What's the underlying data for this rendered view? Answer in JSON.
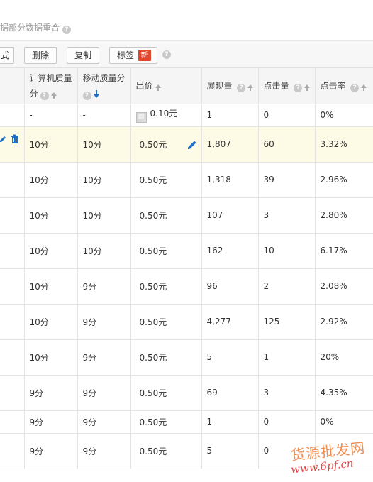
{
  "notice": {
    "text": "据部分数据重合"
  },
  "toolbar": {
    "style_label": "式",
    "delete_label": "删除",
    "copy_label": "复制",
    "tag_label": "标签",
    "new_badge": "新"
  },
  "columns": {
    "pc_quality": "计算机质量",
    "pc_quality_2": "分",
    "mobile_quality": "移动质量分",
    "bid": "出价",
    "impressions": "展现量",
    "clicks": "点击量",
    "ctr": "点击率"
  },
  "rows": [
    {
      "pc_quality": "-",
      "mobile_quality": "-",
      "bid": "0.10元",
      "impressions": "1",
      "clicks": "0",
      "ctr": "0%"
    },
    {
      "pc_quality": "10分",
      "mobile_quality": "10分",
      "bid": "0.50元",
      "impressions": "1,807",
      "clicks": "60",
      "ctr": "3.32%"
    },
    {
      "pc_quality": "10分",
      "mobile_quality": "10分",
      "bid": "0.50元",
      "impressions": "1,318",
      "clicks": "39",
      "ctr": "2.96%"
    },
    {
      "pc_quality": "10分",
      "mobile_quality": "10分",
      "bid": "0.50元",
      "impressions": "107",
      "clicks": "3",
      "ctr": "2.80%"
    },
    {
      "pc_quality": "10分",
      "mobile_quality": "10分",
      "bid": "0.50元",
      "impressions": "162",
      "clicks": "10",
      "ctr": "6.17%"
    },
    {
      "pc_quality": "10分",
      "mobile_quality": "9分",
      "bid": "0.50元",
      "impressions": "96",
      "clicks": "2",
      "ctr": "2.08%"
    },
    {
      "pc_quality": "10分",
      "mobile_quality": "9分",
      "bid": "0.50元",
      "impressions": "4,277",
      "clicks": "125",
      "ctr": "2.92%"
    },
    {
      "pc_quality": "10分",
      "mobile_quality": "9分",
      "bid": "0.50元",
      "impressions": "5",
      "clicks": "1",
      "ctr": "20%"
    },
    {
      "pc_quality": "9分",
      "mobile_quality": "9分",
      "bid": "0.50元",
      "impressions": "69",
      "clicks": "3",
      "ctr": "4.35%"
    },
    {
      "pc_quality": "9分",
      "mobile_quality": "9分",
      "bid": "0.50元",
      "impressions": "1",
      "clicks": "0",
      "ctr": "0%"
    },
    {
      "pc_quality": "9分",
      "mobile_quality": "9分",
      "bid": "0.50元",
      "impressions": "5",
      "clicks": "0",
      "ctr": ""
    }
  ],
  "icons": {
    "help": "question-circle-icon",
    "edit": "pencil-icon",
    "delete": "trash-icon",
    "mobile": "mobile-device-icon"
  },
  "colors": {
    "accent_blue": "#1f6fc7",
    "new_badge": "#e0472c",
    "highlight_row": "#fdfbe6"
  },
  "watermark": {
    "line1": "货源批发网",
    "line2": "www.6pf.cn"
  }
}
